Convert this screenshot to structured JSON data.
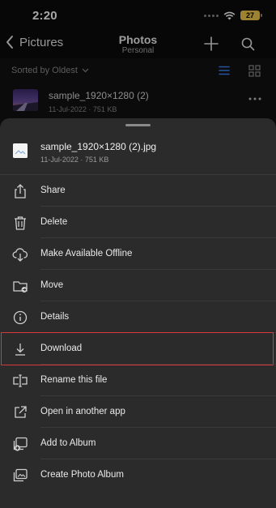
{
  "status_bar": {
    "time": "2:20",
    "battery": "27"
  },
  "nav": {
    "back_label": "Pictures",
    "title": "Photos",
    "subtitle": "Personal"
  },
  "sort": {
    "label": "Sorted by Oldest"
  },
  "file_row": {
    "name": "sample_1920×1280 (2)",
    "meta": "11-Jul-2022 · 751 KB"
  },
  "sheet": {
    "title": "sample_1920×1280 (2).jpg",
    "meta": "11-Jul-2022 · 751 KB",
    "items": [
      {
        "label": "Share",
        "icon": "share-icon"
      },
      {
        "label": "Delete",
        "icon": "trash-icon"
      },
      {
        "label": "Make Available Offline",
        "icon": "cloud-download-icon"
      },
      {
        "label": "Move",
        "icon": "folder-move-icon"
      },
      {
        "label": "Details",
        "icon": "info-icon"
      },
      {
        "label": "Download",
        "icon": "download-icon",
        "highlighted": true
      },
      {
        "label": "Rename this file",
        "icon": "rename-icon"
      },
      {
        "label": "Open in another app",
        "icon": "open-external-icon"
      },
      {
        "label": "Add to Album",
        "icon": "add-to-album-icon"
      },
      {
        "label": "Create Photo Album",
        "icon": "photo-album-icon"
      }
    ]
  },
  "colors": {
    "accent": "#3b82f6",
    "highlight": "#d9363e",
    "sheet_bg": "#2b2b2b"
  }
}
